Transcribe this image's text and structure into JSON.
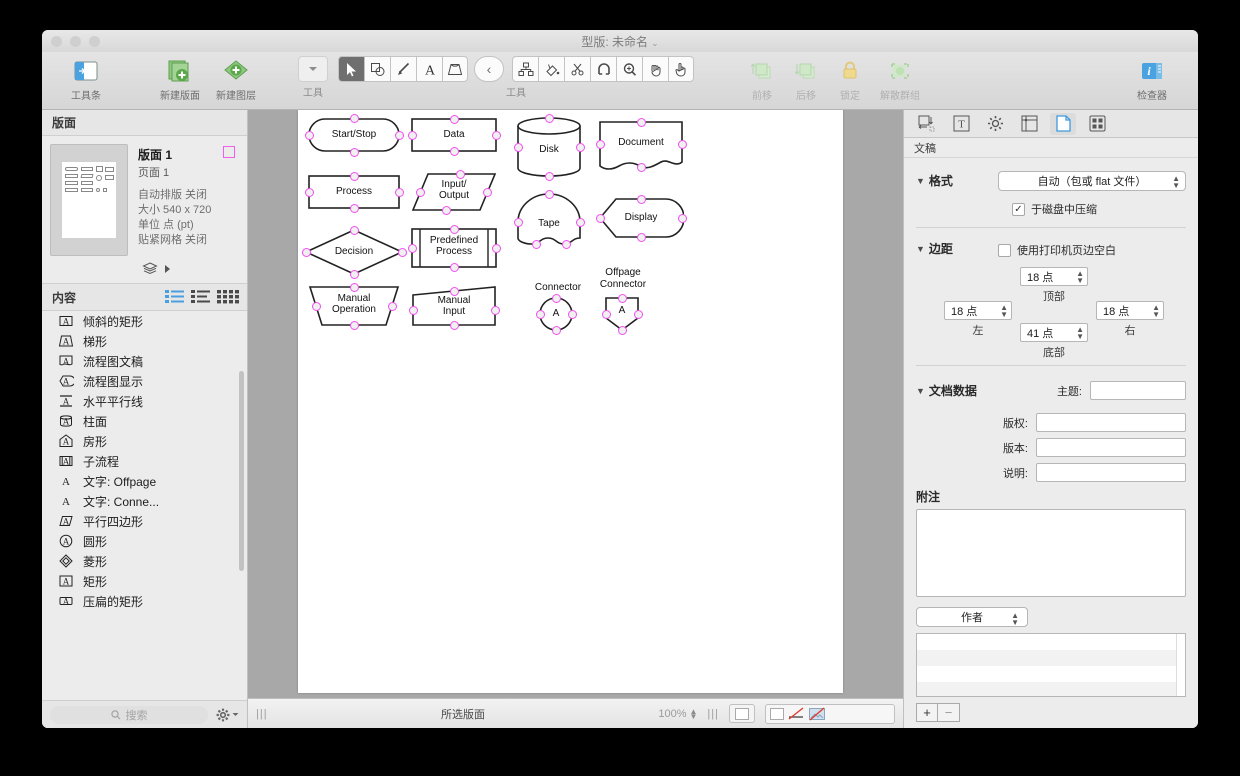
{
  "window": {
    "title": "型版: 未命名",
    "chevron": "⌄"
  },
  "toolbar": {
    "left_buttons": [
      {
        "label": "工具条",
        "icon": "toolbar-icon"
      },
      {
        "label": "新建版面",
        "icon": "new-canvas-icon"
      },
      {
        "label": "新建图层",
        "icon": "new-layer-icon"
      }
    ],
    "tool_group_label": "工具",
    "tools_group_label": "工具",
    "tools": [
      {
        "name": "selection-tool",
        "active": true
      },
      {
        "name": "shape-tool",
        "active": false
      },
      {
        "name": "line-tool",
        "active": false
      },
      {
        "name": "text-tool",
        "active": false
      },
      {
        "name": "perspective-tool",
        "active": false
      }
    ],
    "collapse_tool": {
      "name": "collapse-tool",
      "glyph": "‹"
    },
    "tools2": [
      {
        "name": "diagram-tool"
      },
      {
        "name": "paint-bucket-tool"
      },
      {
        "name": "scissors-tool"
      },
      {
        "name": "magnet-tool"
      },
      {
        "name": "zoom-tool"
      },
      {
        "name": "hand-tool"
      },
      {
        "name": "pointer-hand-tool"
      }
    ],
    "arrange_buttons": [
      {
        "label": "前移",
        "icon": "bring-forward-icon"
      },
      {
        "label": "后移",
        "icon": "send-backward-icon"
      },
      {
        "label": "锁定",
        "icon": "lock-icon"
      },
      {
        "label": "解散群组",
        "icon": "ungroup-icon"
      }
    ],
    "inspector_button": {
      "label": "检查器",
      "icon": "inspector-icon"
    }
  },
  "sidebar": {
    "canvas_header": "版面",
    "canvas": {
      "title": "版面 1",
      "subtitle": "页面 1",
      "props": [
        "自动排版 关闭",
        "大小 540 x 720",
        "单位 点 (pt)",
        "贴紧网格 关闭"
      ]
    },
    "content_header": "内容",
    "view_modes": [
      "list-view-icon",
      "outline-view-icon",
      "grid-view-icon"
    ],
    "items": [
      {
        "icon": "slanted-rect-icon",
        "label": "倾斜的矩形"
      },
      {
        "icon": "trapezoid-icon",
        "label": "梯形"
      },
      {
        "icon": "flowchart-document-icon",
        "label": "流程图文稿"
      },
      {
        "icon": "flowchart-display-icon",
        "label": "流程图显示"
      },
      {
        "icon": "horizontal-lines-icon",
        "label": "水平平行线"
      },
      {
        "icon": "cylinder-icon",
        "label": "柱面"
      },
      {
        "icon": "house-icon",
        "label": "房形"
      },
      {
        "icon": "subprocess-icon",
        "label": "子流程"
      },
      {
        "icon": "text-icon",
        "label": "文字: Offpage"
      },
      {
        "icon": "text-icon",
        "label": "文字: Conne..."
      },
      {
        "icon": "parallelogram-icon",
        "label": "平行四边形"
      },
      {
        "icon": "circle-icon",
        "label": "圆形"
      },
      {
        "icon": "diamond-icon",
        "label": "菱形"
      },
      {
        "icon": "rectangle-icon",
        "label": "矩形"
      },
      {
        "icon": "flat-rect-icon",
        "label": "压扁的矩形"
      }
    ],
    "search_placeholder": "搜索",
    "search_value": "",
    "gear_label": "gear-icon"
  },
  "canvas": {
    "shapes": [
      {
        "name": "start-stop",
        "label": "Start/Stop",
        "type": "rounded"
      },
      {
        "name": "data",
        "label": "Data",
        "type": "rect"
      },
      {
        "name": "disk",
        "label": "Disk",
        "type": "cylinder"
      },
      {
        "name": "document",
        "label": "Document",
        "type": "document"
      },
      {
        "name": "process",
        "label": "Process",
        "type": "rect"
      },
      {
        "name": "input-output",
        "label": "Input/\nOutput",
        "type": "parallelogram"
      },
      {
        "name": "tape",
        "label": "Tape",
        "type": "tape"
      },
      {
        "name": "display",
        "label": "Display",
        "type": "display"
      },
      {
        "name": "decision",
        "label": "Decision",
        "type": "diamond"
      },
      {
        "name": "predefined-process",
        "label": "Predefined\nProcess",
        "type": "predefined"
      },
      {
        "name": "manual-operation",
        "label": "Manual\nOperation",
        "type": "trapezoid"
      },
      {
        "name": "manual-input",
        "label": "Manual\nInput",
        "type": "manual-input"
      },
      {
        "name": "connector",
        "label": "A",
        "outer_label": "Connector",
        "type": "circle"
      },
      {
        "name": "offpage-connector",
        "label": "A",
        "outer_label": "Offpage\nConnector",
        "type": "pentagon"
      }
    ]
  },
  "statusbar": {
    "selection_text": "所选版面",
    "zoom": "100%",
    "grip": "|||"
  },
  "inspector": {
    "tabs": [
      {
        "name": "geometry-tab",
        "active": false
      },
      {
        "name": "text-tab",
        "active": false
      },
      {
        "name": "settings-tab",
        "active": false
      },
      {
        "name": "canvas-tab",
        "active": false
      },
      {
        "name": "document-tab",
        "active": true
      },
      {
        "name": "grid-tab",
        "active": false
      }
    ],
    "title": "文稿",
    "format": {
      "section": "格式",
      "popup_value": "自动（包或 flat 文件）",
      "compress_label": "于磁盘中压缩",
      "compress_checked": true,
      "check_glyph": "✓"
    },
    "margins": {
      "section": "边距",
      "printer_label": "使用打印机页边空白",
      "printer_checked": false,
      "top": {
        "value": "18 点",
        "caption": "顶部"
      },
      "left": {
        "value": "18 点",
        "caption": "左"
      },
      "right": {
        "value": "18 点",
        "caption": "右"
      },
      "bottom": {
        "value": "41 点",
        "caption": "底部"
      }
    },
    "document_data": {
      "section": "文档数据",
      "fields": [
        {
          "label": "主题:",
          "value": ""
        },
        {
          "label": "版权:",
          "value": ""
        },
        {
          "label": "版本:",
          "value": ""
        },
        {
          "label": "说明:",
          "value": ""
        }
      ],
      "notes_label": "附注",
      "notes_value": "",
      "author_popup": "作者",
      "add_button": "+",
      "remove_button": "−"
    }
  }
}
